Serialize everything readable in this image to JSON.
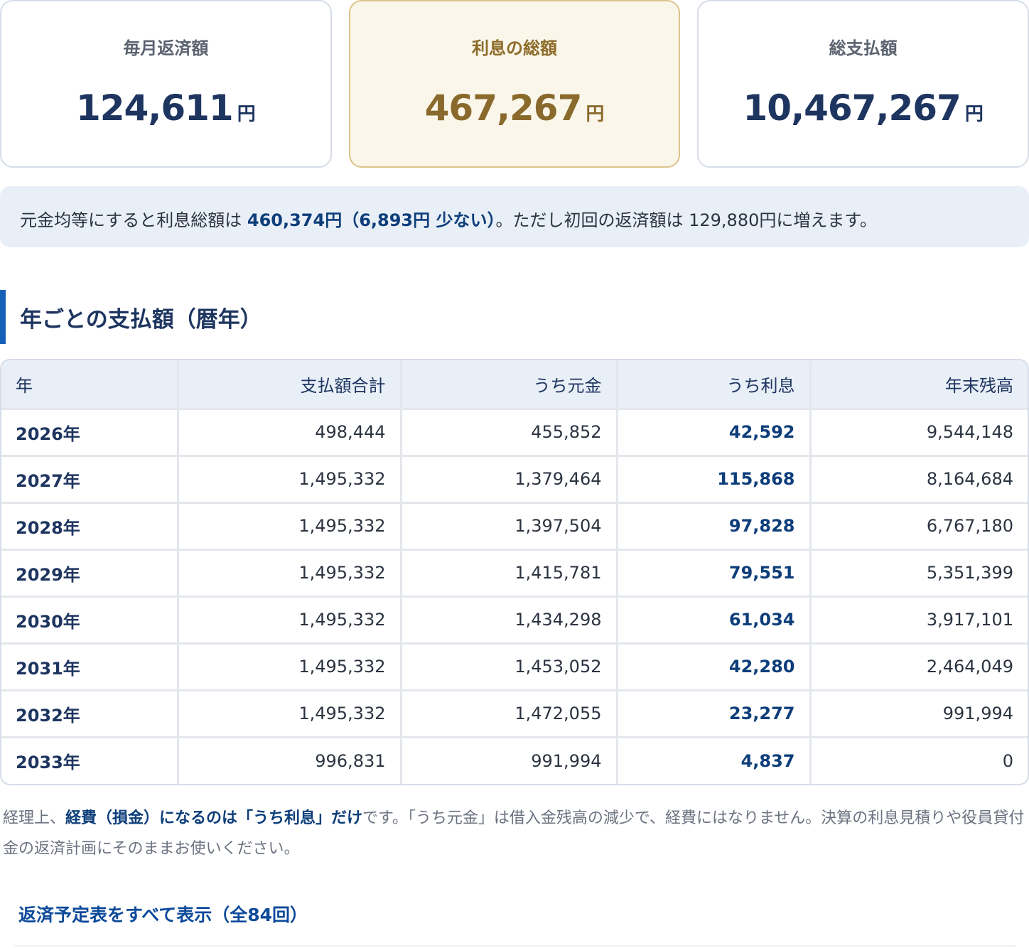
{
  "summary": {
    "monthly": {
      "label": "毎月返済額",
      "value": "124,611",
      "unit": "円"
    },
    "interest_total": {
      "label": "利息の総額",
      "value": "467,267",
      "unit": "円"
    },
    "total_payment": {
      "label": "総支払額",
      "value": "10,467,267",
      "unit": "円"
    }
  },
  "note": {
    "prefix": "元金均等にすると利息総額は",
    "highlight": "460,374円（6,893円 少ない）",
    "suffix": "。ただし初回の返済額は 129,880円に増えます。"
  },
  "section": {
    "title": "年ごとの支払額（暦年）"
  },
  "table": {
    "headers": [
      "年",
      "支払額合計",
      "うち元金",
      "うち利息",
      "年末残高"
    ],
    "rows": [
      [
        "2026年",
        "498,444",
        "455,852",
        "42,592",
        "9,544,148"
      ],
      [
        "2027年",
        "1,495,332",
        "1,379,464",
        "115,868",
        "8,164,684"
      ],
      [
        "2028年",
        "1,495,332",
        "1,397,504",
        "97,828",
        "6,767,180"
      ],
      [
        "2029年",
        "1,495,332",
        "1,415,781",
        "79,551",
        "5,351,399"
      ],
      [
        "2030年",
        "1,495,332",
        "1,434,298",
        "61,034",
        "3,917,101"
      ],
      [
        "2031年",
        "1,495,332",
        "1,453,052",
        "42,280",
        "2,464,049"
      ],
      [
        "2032年",
        "1,495,332",
        "1,472,055",
        "23,277",
        "991,994"
      ],
      [
        "2033年",
        "996,831",
        "991,994",
        "4,837",
        "0"
      ]
    ]
  },
  "footnote": {
    "prefix": "経理上、",
    "emphasis": "経費（損金）になるのは「うち利息」だけ",
    "suffix": "です。「うち元金」は借入金残高の減少で、経費にはなりません。決算の利息見積りや役員貸付金の返済計画にそのままお使いください。"
  },
  "link": {
    "label": "返済予定表をすべて表示（全84回）"
  }
}
